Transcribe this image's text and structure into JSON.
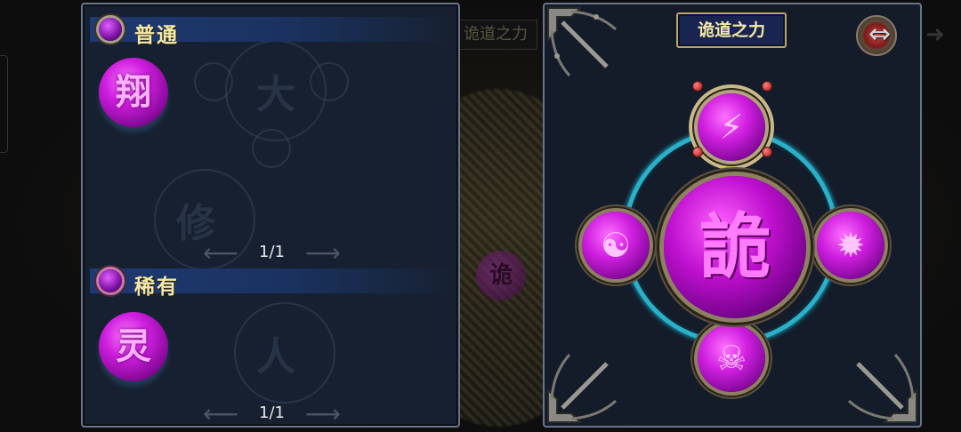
{
  "background": {
    "title": "诡道之力",
    "center_glyph": "诡"
  },
  "left_panel": {
    "common": {
      "label": "普通",
      "rune_glyph": "翔",
      "pager": {
        "current": "1/1"
      }
    },
    "rare": {
      "label": "稀有",
      "rune_glyph": "灵",
      "pager": {
        "current": "1/1"
      }
    }
  },
  "right_panel": {
    "title": "诡道之力",
    "center_glyph": "詭",
    "slots": {
      "top": "⚡",
      "left": "☯",
      "right": "✹",
      "bottom": "☠"
    }
  },
  "colors": {
    "accent_gold": "#f4e9a8",
    "orb_magenta": "#d01fe0",
    "ring_cyan": "#2ab0c8",
    "section_blue": "#1d3a72"
  },
  "icons": {
    "section_gem": "purple-gem-icon",
    "swap": "swap-arrow-icon",
    "page_left": "arrow-left-icon",
    "page_right": "arrow-right-icon",
    "corner": "ornate-corner-icon"
  }
}
